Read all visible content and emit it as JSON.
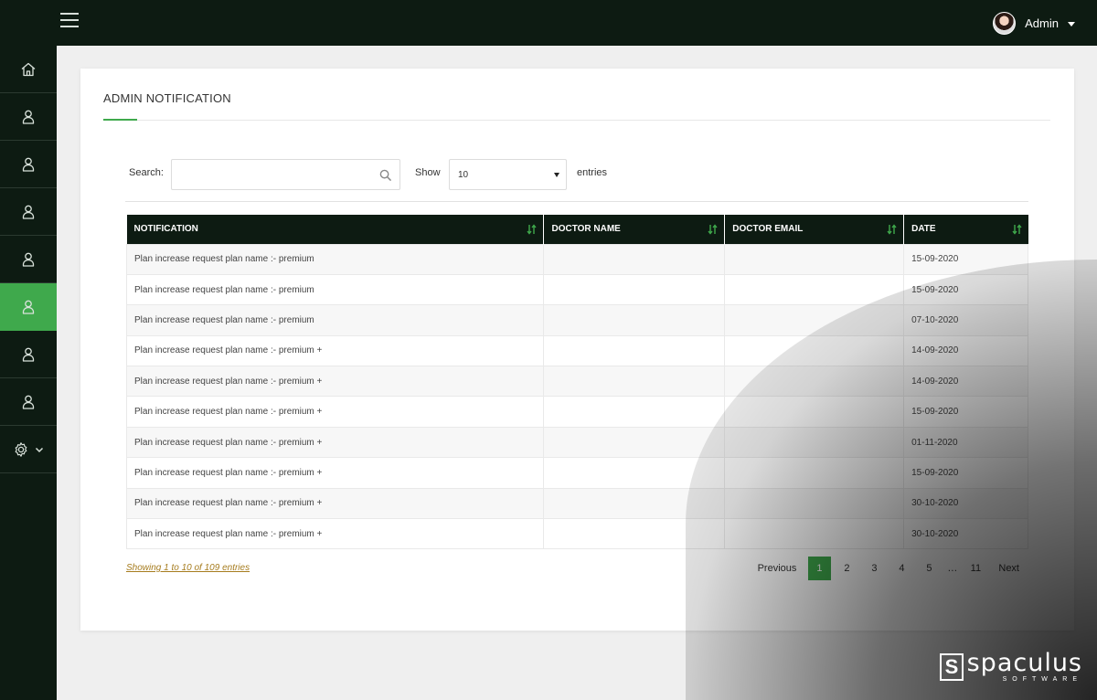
{
  "header": {
    "user_name": "Admin"
  },
  "sidebar": {
    "items": [
      {
        "icon": "home-icon"
      },
      {
        "icon": "user-icon"
      },
      {
        "icon": "user-icon"
      },
      {
        "icon": "user-icon"
      },
      {
        "icon": "user-icon"
      },
      {
        "icon": "user-icon",
        "active": true
      },
      {
        "icon": "user-icon"
      },
      {
        "icon": "user-icon"
      },
      {
        "icon": "gear-icon"
      }
    ]
  },
  "page": {
    "title": "ADMIN NOTIFICATION"
  },
  "controls": {
    "search_label": "Search:",
    "search_value": "",
    "show_label": "Show",
    "entries_value": "10",
    "entries_label": "entries"
  },
  "table": {
    "columns": [
      "NOTIFICATION",
      "DOCTOR NAME",
      "DOCTOR EMAIL",
      "DATE"
    ],
    "rows": [
      {
        "notification": "Plan increase request plan name :- premium",
        "doctor_name": "",
        "doctor_email": "",
        "date": "15-09-2020"
      },
      {
        "notification": "Plan increase request plan name :- premium",
        "doctor_name": "",
        "doctor_email": "",
        "date": "15-09-2020"
      },
      {
        "notification": "Plan increase request plan name :- premium",
        "doctor_name": "",
        "doctor_email": "",
        "date": "07-10-2020"
      },
      {
        "notification": "Plan increase request plan name :- premium +",
        "doctor_name": "",
        "doctor_email": "",
        "date": "14-09-2020"
      },
      {
        "notification": "Plan increase request plan name :- premium +",
        "doctor_name": "",
        "doctor_email": "",
        "date": "14-09-2020"
      },
      {
        "notification": "Plan increase request plan name :- premium +",
        "doctor_name": "",
        "doctor_email": "",
        "date": "15-09-2020"
      },
      {
        "notification": "Plan increase request plan name :- premium +",
        "doctor_name": "",
        "doctor_email": "",
        "date": "01-11-2020"
      },
      {
        "notification": "Plan increase request plan name :- premium +",
        "doctor_name": "",
        "doctor_email": "",
        "date": "15-09-2020"
      },
      {
        "notification": "Plan increase request plan name :- premium +",
        "doctor_name": "",
        "doctor_email": "",
        "date": "30-10-2020"
      },
      {
        "notification": "Plan increase request plan name :- premium +",
        "doctor_name": "",
        "doctor_email": "",
        "date": "30-10-2020"
      }
    ]
  },
  "footer": {
    "showing_text": "Showing 1 to 10 of 109 entries",
    "previous_label": "Previous",
    "next_label": "Next",
    "pages": [
      "1",
      "2",
      "3",
      "4",
      "5",
      "…",
      "11"
    ],
    "active_page": "1"
  },
  "brand": {
    "name": "spaculus",
    "sub": "SOFTWARE"
  },
  "colors": {
    "accent": "#3fa94c",
    "dark": "#0d1b12",
    "link": "#a67c1e"
  }
}
